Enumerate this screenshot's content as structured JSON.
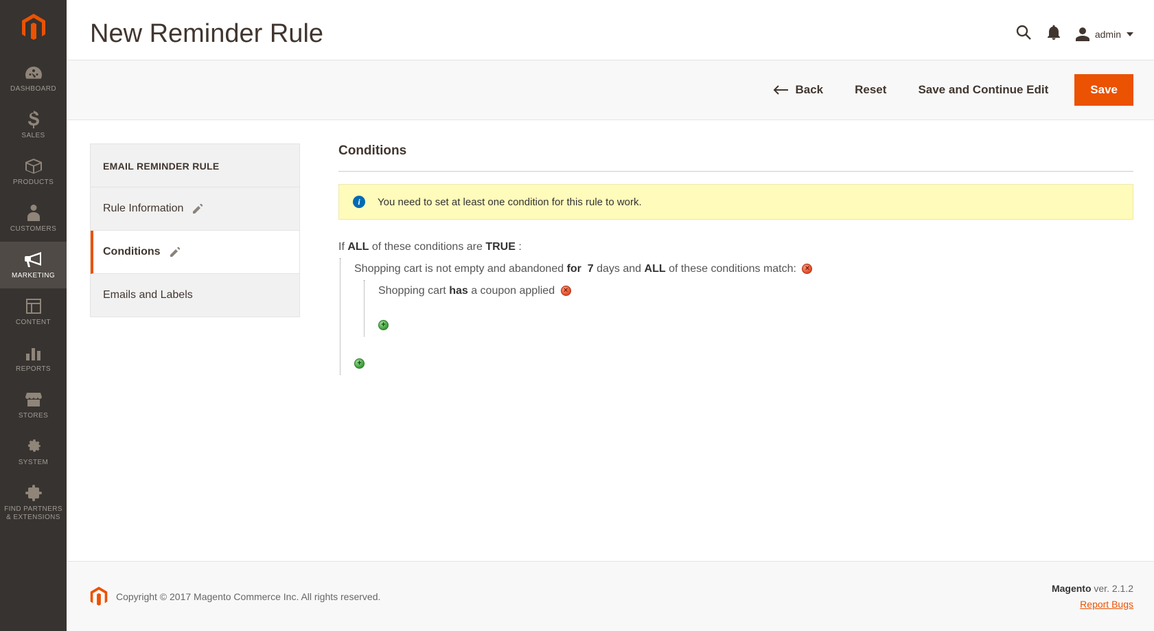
{
  "header": {
    "title": "New Reminder Rule",
    "user_label": "admin"
  },
  "toolbar": {
    "back_label": "Back",
    "reset_label": "Reset",
    "save_continue_label": "Save and Continue Edit",
    "save_label": "Save"
  },
  "sidebar_nav": [
    {
      "label": "DASHBOARD"
    },
    {
      "label": "SALES"
    },
    {
      "label": "PRODUCTS"
    },
    {
      "label": "CUSTOMERS"
    },
    {
      "label": "MARKETING"
    },
    {
      "label": "CONTENT"
    },
    {
      "label": "REPORTS"
    },
    {
      "label": "STORES"
    },
    {
      "label": "SYSTEM"
    },
    {
      "label": "FIND PARTNERS & EXTENSIONS"
    }
  ],
  "tabs": {
    "panel_title": "EMAIL REMINDER RULE",
    "items": [
      {
        "label": "Rule Information"
      },
      {
        "label": "Conditions"
      },
      {
        "label": "Emails and Labels"
      }
    ]
  },
  "conditions": {
    "section_title": "Conditions",
    "info_message": "You need to set at least one condition for this rule to work.",
    "root": {
      "prefix": "If ",
      "aggregator": "ALL",
      "mid": " of these conditions are ",
      "value": "TRUE",
      "suffix": " :"
    },
    "line1": {
      "p1": "Shopping cart is not empty and abandoned ",
      "for_word": "for",
      "days": "7",
      "p2": " days and ",
      "aggregator": "ALL",
      "p3": " of these conditions match:"
    },
    "line2": {
      "p1": "Shopping cart ",
      "has_word": "has",
      "p2": " a coupon applied"
    }
  },
  "footer": {
    "copyright": "Copyright © 2017 Magento Commerce Inc. All rights reserved.",
    "magento": "Magento",
    "ver_prefix": " ver. ",
    "version": "2.1.2",
    "report_bugs": "Report Bugs"
  }
}
